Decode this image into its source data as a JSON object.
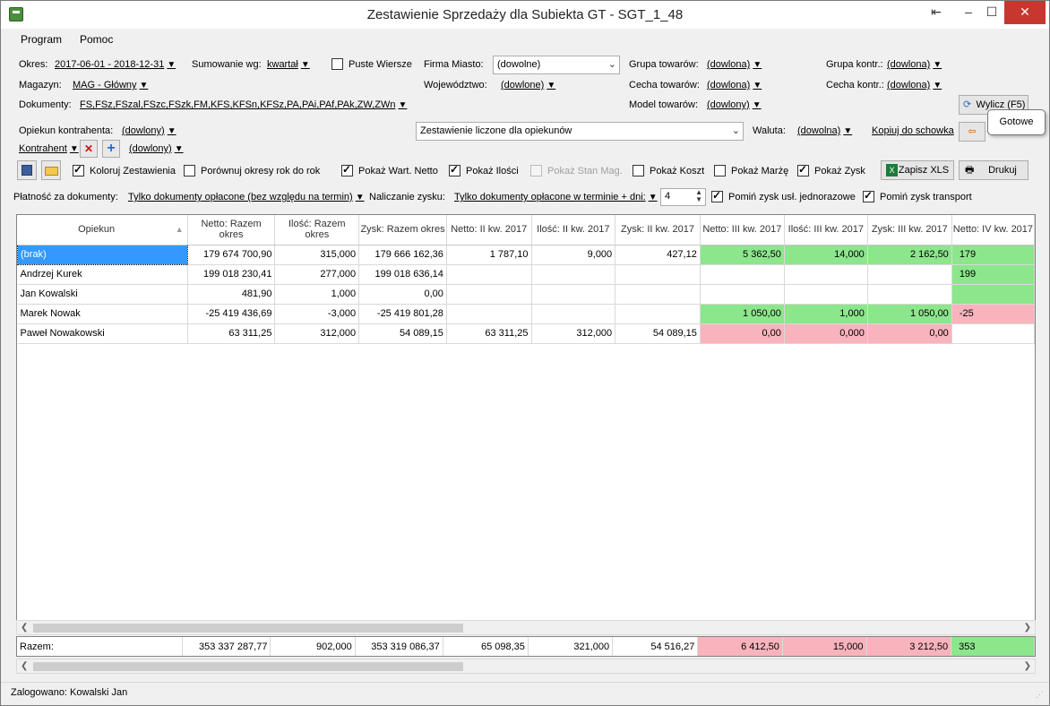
{
  "window": {
    "title": "Zestawienie Sprzedaży dla Subiekta GT - SGT_1_48"
  },
  "menu": {
    "program": "Program",
    "pomoc": "Pomoc"
  },
  "filters": {
    "okres_label": "Okres:",
    "okres_value": "2017-06-01 - 2018-12-31",
    "sumowanie_label": "Sumowanie wg:",
    "sumowanie_value": "kwartał",
    "puste_wiersze": "Puste Wiersze",
    "firma_miasto_label": "Firma Miasto:",
    "firma_miasto_value": "(dowolne)",
    "grupa_towarow_label": "Grupa towarów:",
    "grupa_towarow_value": "(dowlona)",
    "grupa_kontr_label": "Grupa kontr.:",
    "grupa_kontr_value": "(dowlona)",
    "magazyn_label": "Magazyn:",
    "magazyn_value": "MAG - Główny",
    "wojewodztwo_label": "Województwo:",
    "wojewodztwo_value": "(dowlone)",
    "cecha_towarow_label": "Cecha towarów:",
    "cecha_towarow_value": "(dowlona)",
    "cecha_kontr_label": "Cecha kontr.:",
    "cecha_kontr_value": "(dowlona)",
    "dokumenty_label": "Dokumenty:",
    "dokumenty_value": "FS,FSz,FSzal,FSzc,FSzk,FM,KFS,KFSn,KFSz,PA,PAi,PAf,PAk,ZW,ZWn",
    "model_towarow_label": "Model towarów:",
    "model_towarow_value": "(dowlony)",
    "wylicz_button": "Wylicz (F5)",
    "opiekun_label": "Opiekun kontrahenta:",
    "opiekun_value": "(dowlony)",
    "zestawienie_combo": "Zestawienie liczone dla opiekunów",
    "waluta_label": "Waluta:",
    "waluta_value": "(dowolna)",
    "kopiuj": "Kopiuj do schowka",
    "kontrahent_label": "Kontrahent",
    "kontrahent_value": "(dowlony)"
  },
  "toolbar": {
    "koloruj": "Koloruj Zestawienia",
    "porownuj": "Porównuj okresy rok do rok",
    "pokaz_netto": "Pokaż Wart. Netto",
    "pokaz_ilosci": "Pokaż Ilości",
    "pokaz_stan": "Pokaż Stan Mag.",
    "pokaz_koszt": "Pokaż Koszt",
    "pokaz_marze": "Pokaż Marżę",
    "pokaz_zysk": "Pokaż Zysk",
    "zapisz_xls": "Zapisz XLS",
    "drukuj": "Drukuj"
  },
  "options": {
    "platnosc_label": "Płatność za dokumenty:",
    "platnosc_value": "Tylko dokumenty opłacone (bez względu na termin)",
    "naliczanie_label": "Naliczanie zysku:",
    "naliczanie_value": "Tylko dokumenty opłacone w terminie + dni:",
    "dni_value": "4",
    "pomin_usl": "Pomiń zysk usł. jednorazowe",
    "pomin_transport": "Pomiń zysk transport"
  },
  "grid": {
    "headers": [
      "Opiekun",
      "Netto: Razem okres",
      "Ilość: Razem okres",
      "Zysk: Razem okres",
      "Netto: II kw. 2017",
      "Ilość: II kw. 2017",
      "Zysk: II kw. 2017",
      "Netto: III kw. 2017",
      "Ilość: III kw. 2017",
      "Zysk: III kw. 2017",
      "Netto: IV kw. 2017"
    ],
    "rows": [
      [
        "(brak)",
        "179 674 700,90",
        "315,000",
        "179 666 162,36",
        "1 787,10",
        "9,000",
        "427,12",
        "5 362,50",
        "14,000",
        "2 162,50",
        "179"
      ],
      [
        "Andrzej Kurek",
        "199 018 230,41",
        "277,000",
        "199 018 636,14",
        "",
        "",
        "",
        "",
        "",
        "",
        "199"
      ],
      [
        "Jan Kowalski",
        "481,90",
        "1,000",
        "0,00",
        "",
        "",
        "",
        "",
        "",
        "",
        ""
      ],
      [
        "Marek Nowak",
        "-25 419 436,69",
        "-3,000",
        "-25 419 801,28",
        "",
        "",
        "",
        "1 050,00",
        "1,000",
        "1 050,00",
        "-25"
      ],
      [
        "Paweł Nowakowski",
        "63 311,25",
        "312,000",
        "54 089,15",
        "63 311,25",
        "312,000",
        "54 089,15",
        "0,00",
        "0,000",
        "0,00",
        ""
      ]
    ],
    "totals": [
      "Razem:",
      "353 337 287,77",
      "902,000",
      "353 319 086,37",
      "65 098,35",
      "321,000",
      "54 516,27",
      "6 412,50",
      "15,000",
      "3 212,50",
      "353"
    ]
  },
  "tooltip": "Gotowe",
  "status": {
    "text": "Zalogowano: Kowalski Jan"
  }
}
